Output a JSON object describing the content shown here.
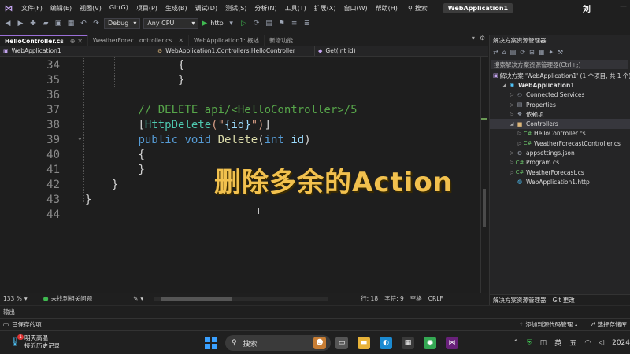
{
  "menubar": {
    "items": [
      "文件(F)",
      "编辑(E)",
      "视图(V)",
      "Git(G)",
      "项目(P)",
      "生成(B)",
      "调试(D)",
      "测试(S)",
      "分析(N)",
      "工具(T)",
      "扩展(X)",
      "窗口(W)",
      "帮助(H)"
    ],
    "search_label": "搜索",
    "project_title": "WebApplication1",
    "user_initial": "刘"
  },
  "toolbar": {
    "config": "Debug",
    "platform": "Any CPU",
    "run_label": "http"
  },
  "tabs": [
    {
      "label": "HelloController.cs",
      "active": true
    },
    {
      "label": "WeatherForec...ontroller.cs",
      "active": false
    },
    {
      "label": "WebApplication1: 概述",
      "active": false
    },
    {
      "label": "新增功能",
      "active": false
    }
  ],
  "navbar": {
    "project": "WebApplication1",
    "class": "WebApplication1.Controllers.HelloController",
    "member": "Get(int id)"
  },
  "code_lines": [
    {
      "num": "34",
      "indent": 14,
      "tokens": [
        {
          "t": "{",
          "c": ""
        }
      ]
    },
    {
      "num": "35",
      "indent": 14,
      "tokens": [
        {
          "t": "}",
          "c": ""
        }
      ]
    },
    {
      "num": "36",
      "indent": 0,
      "tokens": []
    },
    {
      "num": "37",
      "indent": 8,
      "tokens": [
        {
          "t": "// DELETE api/<HelloController>/5",
          "c": "tok-comment"
        }
      ]
    },
    {
      "num": "38",
      "indent": 8,
      "tokens": [
        {
          "t": "[",
          "c": ""
        },
        {
          "t": "HttpDelete",
          "c": "tok-attr"
        },
        {
          "t": "(\"",
          "c": "tok-str"
        },
        {
          "t": "{id}",
          "c": "tok-id"
        },
        {
          "t": "\")",
          "c": "tok-str"
        },
        {
          "t": "]",
          "c": ""
        }
      ]
    },
    {
      "num": "39",
      "indent": 8,
      "tokens": [
        {
          "t": "public",
          "c": "tok-kw"
        },
        {
          "t": " ",
          "c": ""
        },
        {
          "t": "void",
          "c": "tok-kw"
        },
        {
          "t": " ",
          "c": ""
        },
        {
          "t": "Delete",
          "c": "tok-method"
        },
        {
          "t": "(",
          "c": ""
        },
        {
          "t": "int",
          "c": "tok-kw"
        },
        {
          "t": " ",
          "c": ""
        },
        {
          "t": "id",
          "c": "tok-id"
        },
        {
          "t": ")",
          "c": ""
        }
      ]
    },
    {
      "num": "40",
      "indent": 8,
      "tokens": [
        {
          "t": "{",
          "c": ""
        }
      ]
    },
    {
      "num": "41",
      "indent": 8,
      "tokens": [
        {
          "t": "}",
          "c": ""
        }
      ]
    },
    {
      "num": "42",
      "indent": 4,
      "tokens": [
        {
          "t": "}",
          "c": ""
        }
      ]
    },
    {
      "num": "43",
      "indent": 0,
      "tokens": [
        {
          "t": "}",
          "c": ""
        }
      ]
    },
    {
      "num": "44",
      "indent": 0,
      "tokens": []
    }
  ],
  "caption": "删除多余的Action",
  "editor_status": {
    "zoom": "133 %",
    "issues": "未找到相关问题",
    "line": "行: 18",
    "col": "字符: 9",
    "whitespace": "空格",
    "eol": "CRLF"
  },
  "output_label": "输出",
  "statusbar": {
    "saved": "已保存的项",
    "add_source": "添加到源代码管理",
    "select_repo": "选择存储库"
  },
  "solution_explorer": {
    "title": "解决方案资源管理器",
    "search_placeholder": "搜索解决方案资源管理器(Ctrl+;)",
    "items": [
      {
        "label": "解决方案 'WebApplication1' (1 个项目, 共 1 个)",
        "depth": 0,
        "arrow": "",
        "icon": "solution-icon",
        "glyph": "▣",
        "color": "#c5a5f0",
        "selected": false,
        "bold": false
      },
      {
        "label": "WebApplication1",
        "depth": 1,
        "arrow": "◢",
        "icon": "project-icon",
        "glyph": "◉",
        "color": "#4fc3f7",
        "selected": false,
        "bold": true
      },
      {
        "label": "Connected Services",
        "depth": 2,
        "arrow": "▷",
        "icon": "connected-services-icon",
        "glyph": "⚇",
        "color": "#9da5b4",
        "selected": false,
        "bold": false
      },
      {
        "label": "Properties",
        "depth": 2,
        "arrow": "▷",
        "icon": "properties-icon",
        "glyph": "▤",
        "color": "#9da5b4",
        "selected": false,
        "bold": false
      },
      {
        "label": "依赖项",
        "depth": 2,
        "arrow": "▷",
        "icon": "dependencies-icon",
        "glyph": "❖",
        "color": "#9da5b4",
        "selected": false,
        "bold": false
      },
      {
        "label": "Controllers",
        "depth": 2,
        "arrow": "◢",
        "icon": "folder-icon",
        "glyph": "■",
        "color": "#dcb67a",
        "selected": true,
        "bold": false
      },
      {
        "label": "HelloController.cs",
        "depth": 3,
        "arrow": "▷",
        "icon": "csharp-file-icon",
        "glyph": "C#",
        "color": "#6abf69",
        "selected": false,
        "bold": false
      },
      {
        "label": "WeatherForecastController.cs",
        "depth": 3,
        "arrow": "▷",
        "icon": "csharp-file-icon",
        "glyph": "C#",
        "color": "#6abf69",
        "selected": false,
        "bold": false
      },
      {
        "label": "appsettings.json",
        "depth": 2,
        "arrow": "▷",
        "icon": "json-file-icon",
        "glyph": "⚙",
        "color": "#9da5b4",
        "selected": false,
        "bold": false
      },
      {
        "label": "Program.cs",
        "depth": 2,
        "arrow": "▷",
        "icon": "csharp-file-icon",
        "glyph": "C#",
        "color": "#6abf69",
        "selected": false,
        "bold": false
      },
      {
        "label": "WeatherForecast.cs",
        "depth": 2,
        "arrow": "▷",
        "icon": "csharp-file-icon",
        "glyph": "C#",
        "color": "#6abf69",
        "selected": false,
        "bold": false
      },
      {
        "label": "WebApplication1.http",
        "depth": 2,
        "arrow": "",
        "icon": "http-file-icon",
        "glyph": "◍",
        "color": "#4fc3f7",
        "selected": false,
        "bold": false
      }
    ],
    "bottom_tabs": [
      "解决方案资源管理器",
      "Git 更改"
    ]
  },
  "taskbar": {
    "weather_title": "明天高温",
    "weather_sub": "接近历史记录",
    "weather_badge": "1",
    "search_label": "搜索",
    "ime": "英",
    "ime2": "五",
    "clock": "2024"
  },
  "colors": {
    "caption": "#f2c14e",
    "accent": "#9b6fd7",
    "comment": "#57a64a",
    "keyword": "#569cd6"
  }
}
